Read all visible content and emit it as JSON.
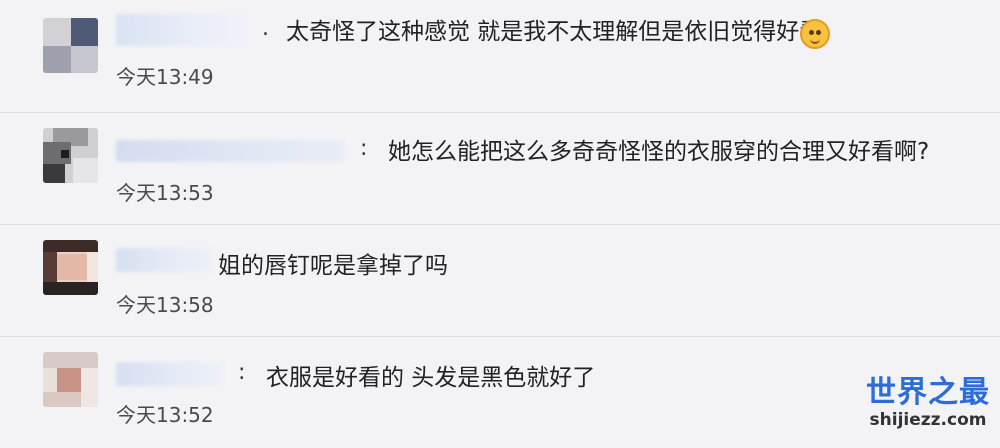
{
  "comments": [
    {
      "separator": ".",
      "text": "太奇怪了这种感觉 就是我不太理解但是依旧觉得好看",
      "emoji": "cat-face-emoji",
      "time": "今天13:49"
    },
    {
      "separator": ":",
      "text": "她怎么能把这么多奇奇怪怪的衣服穿的合理又好看啊?",
      "time": "今天13:53"
    },
    {
      "separator": "",
      "text": "姐的唇钉呢是拿掉了吗",
      "time": "今天13:58"
    },
    {
      "separator": ":",
      "text": "衣服是好看的 头发是黑色就好了",
      "time": "今天13:52"
    }
  ],
  "watermark": {
    "title": "世界之最",
    "url": "shijiezz.com"
  },
  "colors": {
    "background": "#f3f3f6",
    "username": "#3b6fc3",
    "watermark": "#2e6dd6"
  }
}
